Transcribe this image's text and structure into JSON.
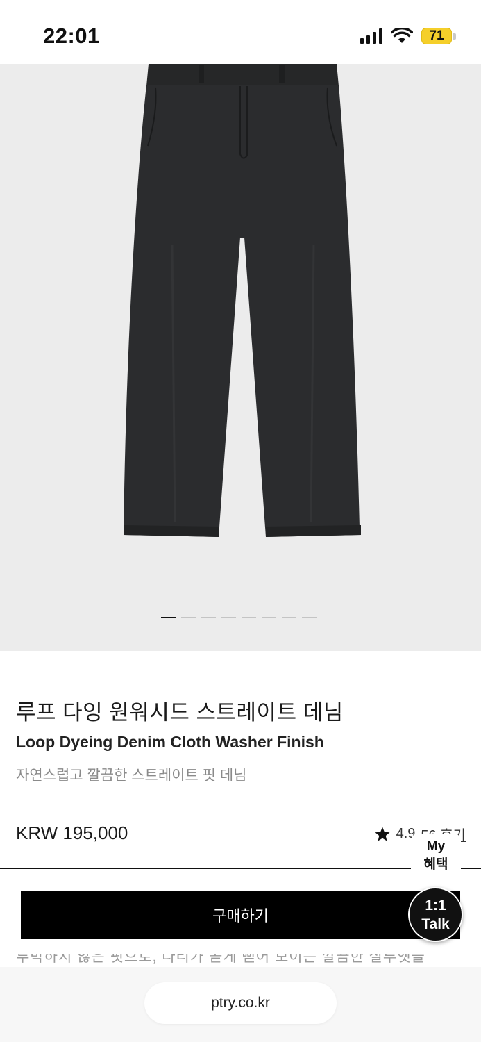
{
  "status_bar": {
    "time": "22:01",
    "battery": "71",
    "icons": [
      "signal-icon",
      "wifi-icon",
      "battery-icon"
    ]
  },
  "product": {
    "image": {
      "icon": "pants-photo",
      "carousel_count": 8,
      "active_index": 0
    },
    "title_ko": "루프 다잉 원워시드 스트레이트 데님",
    "title_en": "Loop Dyeing Denim Cloth Washer Finish",
    "description": "자연스럽고 깔끔한 스트레이트 핏 데님",
    "price": "KRW 195,000",
    "rating": "4.9",
    "review_label": "56 후기"
  },
  "floating": {
    "my_benefit_line1": "My",
    "my_benefit_line2": "혜택",
    "talk_line1": "1:1",
    "talk_line2": "Talk"
  },
  "actions": {
    "buy_label": "구매하기"
  },
  "partial_text": "투박하지 않은 핏으로, 다리가 곧게 뻗어 보이는 깔끔한 실루엣을",
  "browser": {
    "url": "ptry.co.kr"
  },
  "colors": {
    "accent": "#000000",
    "battery": "#f5cf2a",
    "image_bg": "#ececec"
  }
}
